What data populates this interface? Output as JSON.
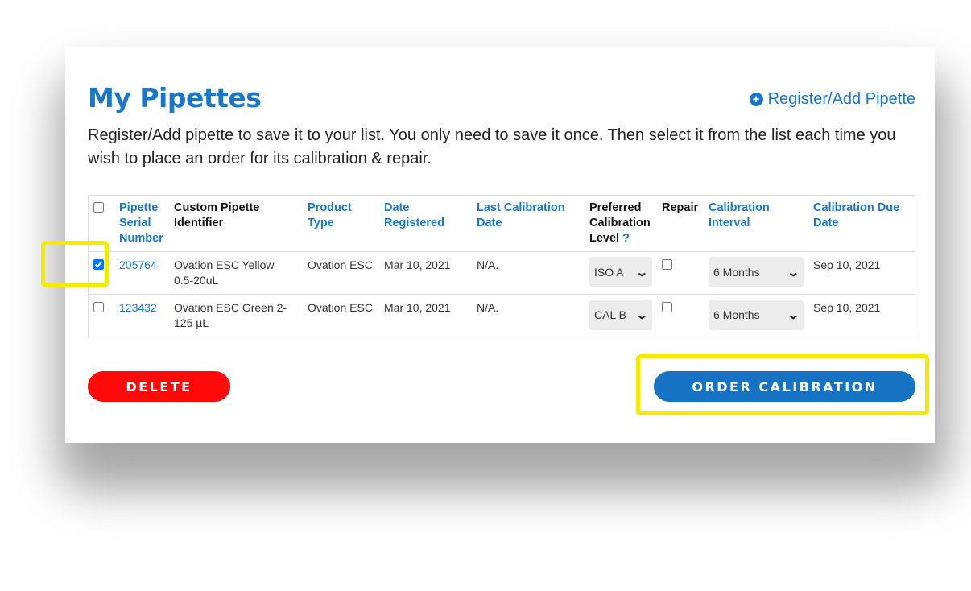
{
  "page": {
    "title": "My Pipettes",
    "register_link": "Register/Add Pipette",
    "intro": "Register/Add pipette to save it to your list. You only need to save it once. Then select it from the list each time you wish to place an order for its calibration & repair."
  },
  "table": {
    "headers": {
      "serial": [
        "Pipette",
        "Serial",
        "Number"
      ],
      "custom": [
        "Custom Pipette",
        "Identifier"
      ],
      "product": [
        "Product",
        "Type"
      ],
      "date_registered": [
        "Date",
        "Registered"
      ],
      "last_cal": [
        "Last Calibration",
        "Date"
      ],
      "level": [
        "Preferred",
        "Calibration",
        "Level"
      ],
      "level_help": "?",
      "repair": "Repair",
      "interval": [
        "Calibration",
        "Interval"
      ],
      "due": [
        "Calibration Due",
        "Date"
      ]
    },
    "rows": [
      {
        "selected": true,
        "serial": "205764",
        "custom": [
          "Ovation ESC Yellow",
          "0.5-20uL"
        ],
        "product": "Ovation ESC",
        "date_registered": "Mar 10, 2021",
        "last_cal": "N/A.",
        "level": "ISO A",
        "repair": false,
        "interval": "6 Months",
        "due": "Sep 10, 2021"
      },
      {
        "selected": false,
        "serial": "123432",
        "custom": [
          "Ovation ESC Green 2-",
          "125 µL"
        ],
        "product": "Ovation ESC",
        "date_registered": "Mar 10, 2021",
        "last_cal": "N/A.",
        "level": "CAL B",
        "repair": false,
        "interval": "6 Months",
        "due": "Sep 10, 2021"
      }
    ]
  },
  "buttons": {
    "delete": "DELETE",
    "order": "ORDER CALIBRATION"
  },
  "icons": {
    "register": "plus-circle-icon",
    "dropdown": "chevron-down-icon"
  },
  "colors": {
    "accent": "#1877c8",
    "delete": "#ff0a0a",
    "highlight": "#f5eb00"
  }
}
